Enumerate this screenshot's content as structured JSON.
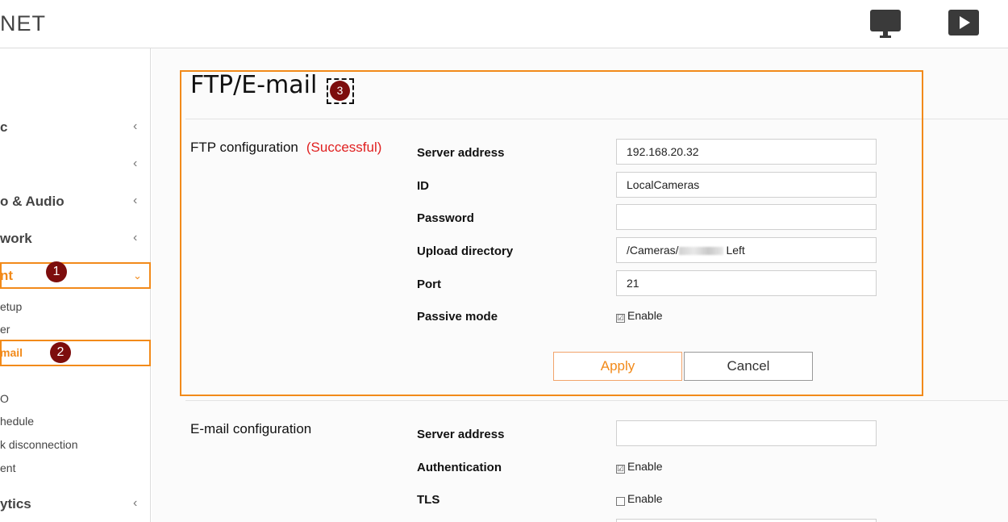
{
  "header": {
    "logo": "NET",
    "monitor_icon": "monitor-icon",
    "play_icon": "play-icon"
  },
  "sidebar": {
    "items": [
      {
        "label": "c",
        "name": "sidebar-item-basic"
      },
      {
        "label": "",
        "name": "sidebar-item-ptz"
      },
      {
        "label": "o & Audio",
        "name": "sidebar-item-video-audio"
      },
      {
        "label": "work",
        "name": "sidebar-item-network"
      },
      {
        "label": "nt",
        "name": "sidebar-item-event"
      },
      {
        "label": "ytics",
        "name": "sidebar-item-analytics"
      }
    ],
    "sub_items": [
      "etup",
      "er",
      "mail",
      "",
      "O",
      "hedule",
      "k disconnection",
      "ent"
    ]
  },
  "annotations": {
    "badge1": "1",
    "badge2": "2",
    "badge3": "3"
  },
  "page": {
    "title": "FTP/E-mail"
  },
  "ftp": {
    "section_label": "FTP configuration",
    "status": "(Successful)",
    "fields": [
      {
        "label": "Server address",
        "value": "192.168.20.32"
      },
      {
        "label": "ID",
        "value": "LocalCameras"
      },
      {
        "label": "Password",
        "value": ""
      },
      {
        "label": "Upload directory",
        "value_prefix": "/Cameras/",
        "value_suffix": " Left"
      },
      {
        "label": "Port",
        "value": "21"
      }
    ],
    "passive_mode_label": "Passive mode",
    "passive_mode_checkbox": "Enable",
    "passive_mode_checked": "☑",
    "apply_label": "Apply",
    "cancel_label": "Cancel"
  },
  "email": {
    "section_label": "E-mail configuration",
    "server_address_label": "Server address",
    "server_address_value": "",
    "authentication_label": "Authentication",
    "authentication_checkbox": "Enable",
    "authentication_checked": "☑",
    "tls_label": "TLS",
    "tls_checkbox": "Enable",
    "tls_checked": "☐"
  },
  "colors": {
    "accent": "#f28a1a",
    "status_success": "#e02020",
    "badge": "#7d0d0d"
  }
}
